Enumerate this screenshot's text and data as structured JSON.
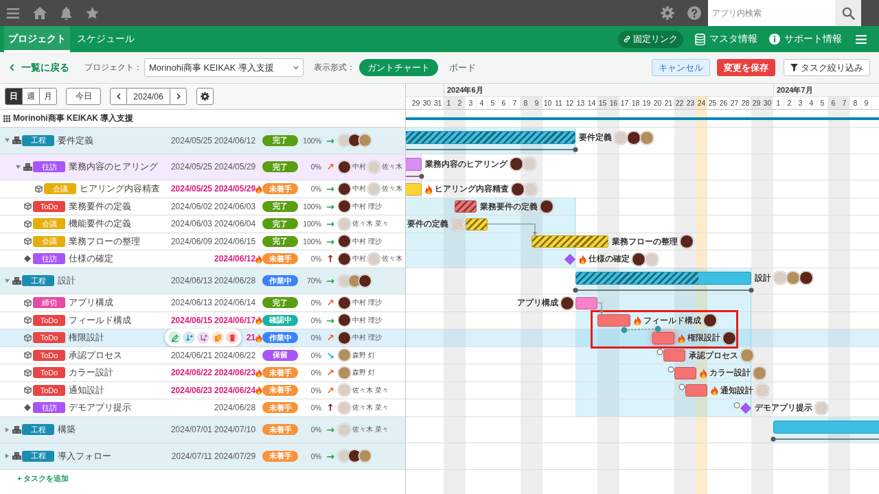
{
  "topbar": {
    "search": {
      "placeholder": "アプリ内検索"
    }
  },
  "nav": {
    "tabs": [
      {
        "label": "プロジェクト",
        "selected": true
      },
      {
        "label": "スケジュール",
        "selected": false
      }
    ],
    "links": [
      {
        "label": "固定リンク",
        "kind": "permalink"
      },
      {
        "label": "マスタ情報",
        "kind": "master"
      },
      {
        "label": "サポート情報",
        "kind": "support"
      }
    ]
  },
  "toolbar": {
    "back": "一覧に戻る",
    "project_label": "プロジェクト：",
    "project": "Morinohi商事 KEIKAK 導入支援",
    "view_label": "表示形式：",
    "views": [
      {
        "label": "ガントチャート",
        "selected": true
      },
      {
        "label": "ボード",
        "selected": false
      }
    ],
    "buttons": [
      {
        "label": "キャンセル",
        "kind": "cancel"
      },
      {
        "label": "変更を保存",
        "kind": "save"
      },
      {
        "label": "タスク絞り込み",
        "kind": "filter"
      }
    ]
  },
  "controls": {
    "scales": [
      {
        "label": "日",
        "selected": true
      },
      {
        "label": "週",
        "selected": false
      },
      {
        "label": "月",
        "selected": false
      }
    ],
    "today": "今日",
    "month": "2024/06"
  },
  "timeline": {
    "months": [
      {
        "days": [
          {
            "label": "29",
            "weekend": false,
            "today": false
          },
          {
            "label": "30",
            "weekend": false,
            "today": false
          },
          {
            "label": "31",
            "weekend": false,
            "today": false
          }
        ]
      },
      {
        "label": "2024年6月",
        "days": [
          {
            "label": "1",
            "weekend": true,
            "today": false
          },
          {
            "label": "2",
            "weekend": true,
            "today": false
          },
          {
            "label": "3",
            "weekend": false,
            "today": false
          },
          {
            "label": "4",
            "weekend": false,
            "today": false
          },
          {
            "label": "5",
            "weekend": false,
            "today": false
          },
          {
            "label": "6",
            "weekend": false,
            "today": false
          },
          {
            "label": "7",
            "weekend": false,
            "today": false
          },
          {
            "label": "8",
            "weekend": true,
            "today": false
          },
          {
            "label": "9",
            "weekend": true,
            "today": false
          },
          {
            "label": "10",
            "weekend": false,
            "today": false
          },
          {
            "label": "11",
            "weekend": false,
            "today": false
          },
          {
            "label": "12",
            "weekend": false,
            "today": false
          },
          {
            "label": "13",
            "weekend": false,
            "today": false
          },
          {
            "label": "14",
            "weekend": false,
            "today": false
          },
          {
            "label": "15",
            "weekend": true,
            "today": false
          },
          {
            "label": "16",
            "weekend": true,
            "today": false
          },
          {
            "label": "17",
            "weekend": false,
            "today": false
          },
          {
            "label": "18",
            "weekend": false,
            "today": false
          },
          {
            "label": "19",
            "weekend": false,
            "today": false
          },
          {
            "label": "20",
            "weekend": false,
            "today": false
          },
          {
            "label": "21",
            "weekend": false,
            "today": false
          },
          {
            "label": "22",
            "weekend": true,
            "today": false
          },
          {
            "label": "23",
            "weekend": true,
            "today": false
          },
          {
            "label": "24",
            "weekend": false,
            "today": true
          },
          {
            "label": "25",
            "weekend": false,
            "today": false
          },
          {
            "label": "26",
            "weekend": false,
            "today": false
          },
          {
            "label": "27",
            "weekend": false,
            "today": false
          },
          {
            "label": "28",
            "weekend": false,
            "today": false
          },
          {
            "label": "29",
            "weekend": true,
            "today": false
          },
          {
            "label": "30",
            "weekend": true,
            "today": false
          }
        ]
      },
      {
        "label": "2024年7月",
        "days": [
          {
            "label": "1",
            "weekend": false,
            "today": false
          },
          {
            "label": "2",
            "weekend": false,
            "today": false
          },
          {
            "label": "3",
            "weekend": false,
            "today": false
          },
          {
            "label": "4",
            "weekend": false,
            "today": false
          },
          {
            "label": "5",
            "weekend": false,
            "today": false
          },
          {
            "label": "6",
            "weekend": true,
            "today": false
          },
          {
            "label": "7",
            "weekend": true,
            "today": false
          },
          {
            "label": "8",
            "weekend": false,
            "today": false
          },
          {
            "label": "9",
            "weekend": false,
            "today": false
          }
        ]
      }
    ]
  },
  "project": {
    "name": "Morinohi商事 KEIKAK 導入支援"
  },
  "tasks": [
    {
      "kind": "group",
      "expanded": true,
      "selected": false,
      "tag": {
        "label": "工程",
        "color": "#1b8db1"
      },
      "name": "要件定義",
      "start": "2024/05/25",
      "end": "2024/06/12",
      "overdue": false,
      "status": {
        "label": "完了",
        "color": "#5a9e12"
      },
      "progress": "100%",
      "trend": {
        "symbol": "→",
        "color": "#1a9e4a"
      },
      "assignees": [
        {
          "color": "#d9cfc7"
        },
        {
          "color": "#5b2519"
        },
        {
          "color": "#b38f5e"
        }
      ],
      "bar": {
        "kind": "summary",
        "color": "#3bbfe2",
        "label": "要件定義",
        "label_left": false,
        "handle": false
      },
      "children": [
        {
          "kind": "group",
          "expanded": true,
          "selected": false,
          "tag": {
            "label": "往訪",
            "color": "#a855f7"
          },
          "name": "業務内容のヒアリング",
          "start": "2024/05/25",
          "end": "2024/05/29",
          "overdue": false,
          "status": {
            "label": "完了",
            "color": "#5a9e12"
          },
          "progress": "0%",
          "trend": {
            "symbol": "↗",
            "color": "#f0621f"
          },
          "assignees": [
            {
              "name": "中村",
              "color": "#5b2519"
            },
            {
              "name": "佐々木",
              "color": "#d9cfc7"
            }
          ],
          "bar": {
            "kind": "summary",
            "color": "#d98cf2",
            "label": "業務内容のヒアリング",
            "label_left": false,
            "handle": false
          },
          "children": [
            {
              "kind": "task",
              "selected": false,
              "tag": {
                "label": "会議",
                "color": "#e6ae0c"
              },
              "name": "ヒアリング内容精査",
              "start": "2024/05/25",
              "end": "2024/05/29",
              "overdue": true,
              "status": {
                "label": "未着手",
                "color": "#f7923a"
              },
              "progress": "0%",
              "trend": {
                "symbol": "→",
                "color": "#1a9e4a"
              },
              "assignees": [
                {
                  "name": "中村",
                  "color": "#5b2519"
                },
                {
                  "name": "佐々木",
                  "color": "#d9cfc7"
                }
              ],
              "bar": {
                "kind": "task",
                "color": "#fcd535",
                "label": "ヒアリング内容精査",
                "label_left": false,
                "handle": false
              }
            }
          ]
        },
        {
          "kind": "task",
          "selected": false,
          "tag": {
            "label": "ToDo",
            "color": "#e84545"
          },
          "name": "業務要件の定義",
          "start": "2024/06/02",
          "end": "2024/06/03",
          "overdue": false,
          "status": {
            "label": "完了",
            "color": "#5a9e12"
          },
          "progress": "100%",
          "trend": {
            "symbol": "→",
            "color": "#1a9e4a"
          },
          "assignees": [
            {
              "name": "中村 理沙",
              "color": "#5b2519"
            }
          ],
          "bar": {
            "kind": "task",
            "color": "#f47272",
            "label": "業務要件の定義",
            "label_left": false,
            "handle": false
          }
        },
        {
          "kind": "task",
          "selected": false,
          "tag": {
            "label": "会議",
            "color": "#e6ae0c"
          },
          "name": "機能要件の定義",
          "start": "2024/06/03",
          "end": "2024/06/04",
          "overdue": false,
          "status": {
            "label": "完了",
            "color": "#5a9e12"
          },
          "progress": "100%",
          "trend": {
            "symbol": "→",
            "color": "#1a9e4a"
          },
          "assignees": [
            {
              "name": "佐々木 菜々",
              "color": "#d9cfc7"
            }
          ],
          "bar": {
            "kind": "task",
            "color": "#fcd535",
            "label": "要件の定義",
            "label_left": true,
            "handle": false
          }
        },
        {
          "kind": "task",
          "selected": false,
          "tag": {
            "label": "会議",
            "color": "#e6ae0c"
          },
          "name": "業務フローの整理",
          "start": "2024/06/09",
          "end": "2024/06/15",
          "overdue": false,
          "status": {
            "label": "完了",
            "color": "#5a9e12"
          },
          "progress": "100%",
          "trend": {
            "symbol": "→",
            "color": "#1a9e4a"
          },
          "assignees": [
            {
              "name": "中村 理沙",
              "color": "#5b2519"
            }
          ],
          "bar": {
            "kind": "task",
            "color": "#fcd535",
            "label": "業務フローの整理",
            "label_left": false,
            "handle": false,
            "link": {
              "kind": "solid"
            }
          }
        },
        {
          "kind": "milestone",
          "selected": false,
          "tag": {
            "label": "往訪",
            "color": "#a855f7"
          },
          "name": "仕様の確定",
          "end": "2024/06/12",
          "overdue": true,
          "status": {
            "label": "未着手",
            "color": "#f7923a"
          },
          "progress": "0%",
          "trend": {
            "symbol": "↑",
            "color": "#8b1a1a"
          },
          "assignees": [
            {
              "name": "中村",
              "color": "#5b2519"
            },
            {
              "name": "佐々木",
              "color": "#d9cfc7"
            }
          ],
          "bar": {
            "kind": "milestone",
            "color": "#a855f7",
            "label": "仕様の確定",
            "label_left": false,
            "handle": false
          }
        }
      ]
    },
    {
      "kind": "group",
      "expanded": true,
      "selected": false,
      "tag": {
        "label": "工程",
        "color": "#1b8db1"
      },
      "name": "設計",
      "start": "2024/06/13",
      "end": "2024/06/28",
      "overdue": false,
      "status": {
        "label": "作業中",
        "color": "#3b82f6"
      },
      "progress": "70%",
      "trend": {
        "symbol": "→",
        "color": "#1a9e4a"
      },
      "assignees": [
        {
          "color": "#d9cfc7"
        },
        {
          "color": "#b38f5e"
        },
        {
          "color": "#5b2519"
        }
      ],
      "bar": {
        "kind": "summary",
        "color": "#3bbfe2",
        "label": "設計",
        "label_left": false,
        "handle": false
      },
      "children": [
        {
          "kind": "task",
          "selected": false,
          "tag": {
            "label": "締切",
            "color": "#e64ba5"
          },
          "name": "アプリ構成",
          "start": "2024/06/13",
          "end": "2024/06/14",
          "overdue": false,
          "status": {
            "label": "完了",
            "color": "#5a9e12"
          },
          "progress": "0%",
          "trend": {
            "symbol": "↗",
            "color": "#f0621f"
          },
          "assignees": [
            {
              "name": "中村 理沙",
              "color": "#5b2519"
            }
          ],
          "bar": {
            "kind": "task",
            "color": "#f97fcb",
            "label": "アプリ構成",
            "label_left": true,
            "handle": false
          }
        },
        {
          "kind": "task",
          "selected": false,
          "tag": {
            "label": "ToDo",
            "color": "#e84545"
          },
          "name": "フィールド構成",
          "start": "2024/06/15",
          "end": "2024/06/17",
          "overdue": true,
          "status": {
            "label": "確認中",
            "color": "#17b3a3"
          },
          "progress": "0%",
          "trend": {
            "symbol": "→",
            "color": "#1a9e4a"
          },
          "assignees": [
            {
              "name": "中村 理沙",
              "color": "#5b2519"
            }
          ],
          "bar": {
            "kind": "task",
            "color": "#f47272",
            "label": "フィールド構成",
            "label_left": false,
            "handle": false,
            "link": {
              "kind": "solid"
            }
          }
        },
        {
          "kind": "task",
          "selected": true,
          "tag": {
            "label": "ToDo",
            "color": "#e84545"
          },
          "name": "権限設計",
          "end": "21",
          "overdue": true,
          "status": {
            "label": "作業中",
            "color": "#3b82f6"
          },
          "progress": "0%",
          "trend": {
            "symbol": "↗",
            "color": "#f0621f"
          },
          "assignees": [
            {
              "name": "中村 理沙",
              "color": "#5b2519"
            }
          ],
          "bar": {
            "kind": "task",
            "color": "#f47272",
            "label": "権限設計",
            "label_left": false,
            "handle": false,
            "link": {
              "kind": "dashed"
            }
          }
        },
        {
          "kind": "task",
          "selected": false,
          "tag": {
            "label": "ToDo",
            "color": "#e84545"
          },
          "name": "承認プロセス",
          "start": "2024/06/21",
          "end": "2024/06/22",
          "overdue": false,
          "status": {
            "label": "保留",
            "color": "#a855f7"
          },
          "progress": "0%",
          "trend": {
            "symbol": "↘",
            "color": "#1ab4e6"
          },
          "assignees": [
            {
              "name": "森野 灯",
              "color": "#b38f5e"
            }
          ],
          "bar": {
            "kind": "task",
            "color": "#f47272",
            "label": "承認プロセス",
            "label_left": false,
            "handle": true
          }
        },
        {
          "kind": "task",
          "selected": false,
          "tag": {
            "label": "ToDo",
            "color": "#e84545"
          },
          "name": "カラー設計",
          "start": "2024/06/22",
          "end": "2024/06/23",
          "overdue": true,
          "status": {
            "label": "未着手",
            "color": "#f7923a"
          },
          "progress": "0%",
          "trend": {
            "symbol": "↗",
            "color": "#f0621f"
          },
          "assignees": [
            {
              "name": "森野 灯",
              "color": "#b38f5e"
            }
          ],
          "bar": {
            "kind": "task",
            "color": "#f47272",
            "label": "カラー設計",
            "label_left": false,
            "handle": true
          }
        },
        {
          "kind": "task",
          "selected": false,
          "tag": {
            "label": "ToDo",
            "color": "#e84545"
          },
          "name": "通知設計",
          "start": "2024/06/23",
          "end": "2024/06/24",
          "overdue": true,
          "status": {
            "label": "未着手",
            "color": "#f7923a"
          },
          "progress": "0%",
          "trend": {
            "symbol": "↗",
            "color": "#f0621f"
          },
          "assignees": [
            {
              "name": "佐々木 菜々",
              "color": "#d9cfc7"
            }
          ],
          "bar": {
            "kind": "task",
            "color": "#f47272",
            "label": "通知設計",
            "label_left": false,
            "handle": true
          }
        },
        {
          "kind": "milestone",
          "selected": false,
          "tag": {
            "label": "往訪",
            "color": "#a855f7"
          },
          "name": "デモアプリ提示",
          "end": "2024/06/28",
          "overdue": false,
          "status": {
            "label": "未着手",
            "color": "#f7923a"
          },
          "progress": "0%",
          "trend": {
            "symbol": "↑",
            "color": "#8b1a1a"
          },
          "assignees": [
            {
              "name": "佐々木 菜々",
              "color": "#d9cfc7"
            }
          ],
          "bar": {
            "kind": "milestone",
            "color": "#a855f7",
            "label": "デモアプリ提示",
            "label_left": false,
            "handle": true
          }
        }
      ]
    },
    {
      "kind": "group",
      "expanded": false,
      "selected": false,
      "tag": {
        "label": "工程",
        "color": "#1b8db1"
      },
      "name": "構築",
      "start": "2024/07/01",
      "end": "2024/07/10",
      "overdue": false,
      "status": {
        "label": "未着手",
        "color": "#f7923a"
      },
      "progress": "0%",
      "trend": {
        "symbol": "→",
        "color": "#1a9e4a"
      },
      "assignees": [
        {
          "name": "佐々木 菜々",
          "color": "#d9cfc7"
        }
      ],
      "bar": {
        "kind": "summary",
        "color": "#3bbfe2",
        "handle": false
      }
    },
    {
      "kind": "group",
      "expanded": false,
      "selected": false,
      "tag": {
        "label": "工程",
        "color": "#1b8db1"
      },
      "name": "導入フォロー",
      "start": "2024/07/11",
      "end": "2024/07/29",
      "overdue": false,
      "status": {
        "label": "未着手",
        "color": "#f7923a"
      },
      "progress": "0%",
      "trend": {
        "symbol": "→",
        "color": "#1a9e4a"
      },
      "assignees": [
        {
          "color": "#d9cfc7"
        },
        {
          "color": "#5b2519"
        },
        {
          "color": "#b38f5e"
        }
      ]
    }
  ],
  "add_task": "+ タスクを追加"
}
